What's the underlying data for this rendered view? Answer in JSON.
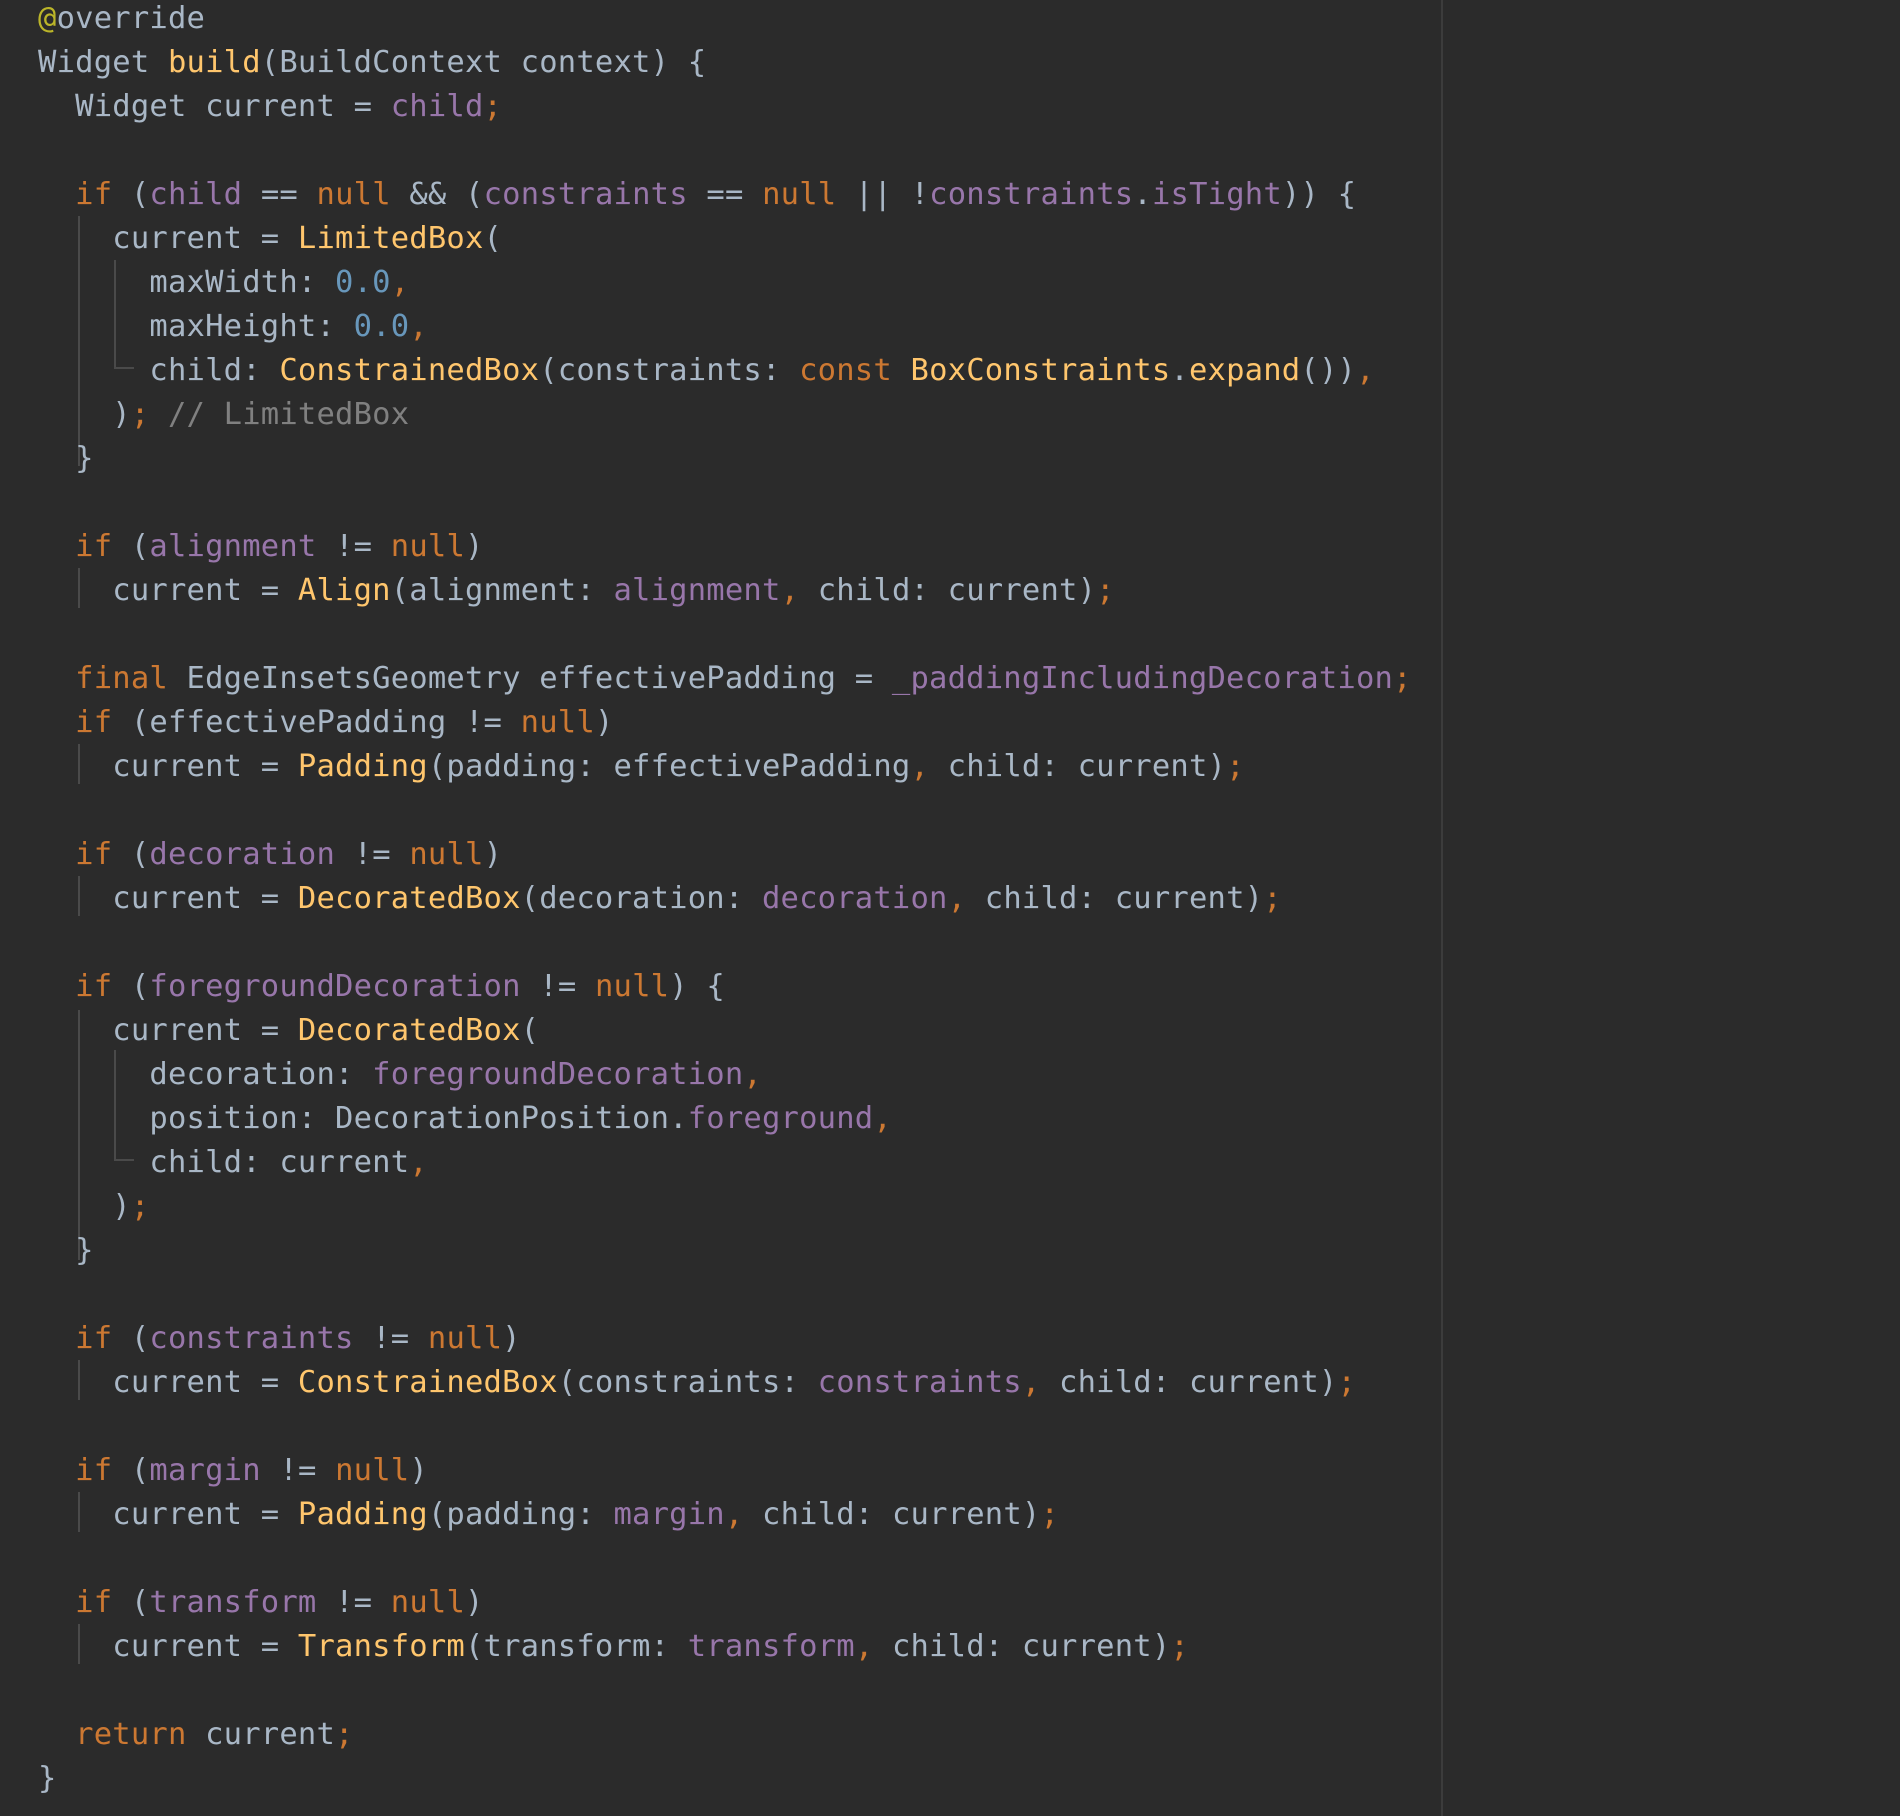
{
  "colors": {
    "background": "#2b2b2b",
    "plain": "#a9b7c6",
    "keyword": "#cc7832",
    "function": "#ffc66d",
    "field": "#9876aa",
    "number": "#6897bb",
    "comment": "#808080",
    "annotation": "#bbb529"
  },
  "code_lines": [
    [
      {
        "t": "@",
        "c": "anno"
      },
      {
        "t": "override",
        "c": "text"
      }
    ],
    [
      {
        "t": "Widget ",
        "c": "text"
      },
      {
        "t": "build",
        "c": "fn"
      },
      {
        "t": "(BuildContext context) {",
        "c": "text"
      }
    ],
    [
      {
        "t": "  Widget current = ",
        "c": "text"
      },
      {
        "t": "child",
        "c": "field"
      },
      {
        "t": ";",
        "c": "punct"
      }
    ],
    [],
    [
      {
        "t": "  ",
        "c": "text"
      },
      {
        "t": "if",
        "c": "kw"
      },
      {
        "t": " (",
        "c": "text"
      },
      {
        "t": "child",
        "c": "field"
      },
      {
        "t": " == ",
        "c": "text"
      },
      {
        "t": "null",
        "c": "kw"
      },
      {
        "t": " && (",
        "c": "text"
      },
      {
        "t": "constraints",
        "c": "field"
      },
      {
        "t": " == ",
        "c": "text"
      },
      {
        "t": "null",
        "c": "kw"
      },
      {
        "t": " || !",
        "c": "text"
      },
      {
        "t": "constraints",
        "c": "field"
      },
      {
        "t": ".",
        "c": "text"
      },
      {
        "t": "isTight",
        "c": "field"
      },
      {
        "t": ")) {",
        "c": "text"
      }
    ],
    [
      {
        "t": "    current = ",
        "c": "text"
      },
      {
        "t": "LimitedBox",
        "c": "fn"
      },
      {
        "t": "(",
        "c": "text"
      }
    ],
    [
      {
        "t": "      maxWidth: ",
        "c": "text"
      },
      {
        "t": "0.0",
        "c": "num"
      },
      {
        "t": ",",
        "c": "punct"
      }
    ],
    [
      {
        "t": "      maxHeight: ",
        "c": "text"
      },
      {
        "t": "0.0",
        "c": "num"
      },
      {
        "t": ",",
        "c": "punct"
      }
    ],
    [
      {
        "t": "      child: ",
        "c": "text"
      },
      {
        "t": "ConstrainedBox",
        "c": "fn"
      },
      {
        "t": "(constraints: ",
        "c": "text"
      },
      {
        "t": "const",
        "c": "kw"
      },
      {
        "t": " ",
        "c": "text"
      },
      {
        "t": "BoxConstraints",
        "c": "fn"
      },
      {
        "t": ".",
        "c": "text"
      },
      {
        "t": "expand",
        "c": "fn"
      },
      {
        "t": "())",
        "c": "text"
      },
      {
        "t": ",",
        "c": "punct"
      }
    ],
    [
      {
        "t": "    )",
        "c": "text"
      },
      {
        "t": ";",
        "c": "punct"
      },
      {
        "t": " // LimitedBox",
        "c": "cmt"
      }
    ],
    [
      {
        "t": "  }",
        "c": "text"
      }
    ],
    [],
    [
      {
        "t": "  ",
        "c": "text"
      },
      {
        "t": "if",
        "c": "kw"
      },
      {
        "t": " (",
        "c": "text"
      },
      {
        "t": "alignment",
        "c": "field"
      },
      {
        "t": " != ",
        "c": "text"
      },
      {
        "t": "null",
        "c": "kw"
      },
      {
        "t": ")",
        "c": "text"
      }
    ],
    [
      {
        "t": "    current = ",
        "c": "text"
      },
      {
        "t": "Align",
        "c": "fn"
      },
      {
        "t": "(alignment: ",
        "c": "text"
      },
      {
        "t": "alignment",
        "c": "field"
      },
      {
        "t": ", ",
        "c": "punct"
      },
      {
        "t": "child: current)",
        "c": "text"
      },
      {
        "t": ";",
        "c": "punct"
      }
    ],
    [],
    [
      {
        "t": "  ",
        "c": "text"
      },
      {
        "t": "final",
        "c": "kw"
      },
      {
        "t": " EdgeInsetsGeometry effectivePadding = ",
        "c": "text"
      },
      {
        "t": "_paddingIncludingDecoration",
        "c": "field"
      },
      {
        "t": ";",
        "c": "punct"
      }
    ],
    [
      {
        "t": "  ",
        "c": "text"
      },
      {
        "t": "if",
        "c": "kw"
      },
      {
        "t": " (effectivePadding != ",
        "c": "text"
      },
      {
        "t": "null",
        "c": "kw"
      },
      {
        "t": ")",
        "c": "text"
      }
    ],
    [
      {
        "t": "    current = ",
        "c": "text"
      },
      {
        "t": "Padding",
        "c": "fn"
      },
      {
        "t": "(padding: effectivePadding",
        "c": "text"
      },
      {
        "t": ", ",
        "c": "punct"
      },
      {
        "t": "child: current)",
        "c": "text"
      },
      {
        "t": ";",
        "c": "punct"
      }
    ],
    [],
    [
      {
        "t": "  ",
        "c": "text"
      },
      {
        "t": "if",
        "c": "kw"
      },
      {
        "t": " (",
        "c": "text"
      },
      {
        "t": "decoration",
        "c": "field"
      },
      {
        "t": " != ",
        "c": "text"
      },
      {
        "t": "null",
        "c": "kw"
      },
      {
        "t": ")",
        "c": "text"
      }
    ],
    [
      {
        "t": "    current = ",
        "c": "text"
      },
      {
        "t": "DecoratedBox",
        "c": "fn"
      },
      {
        "t": "(decoration: ",
        "c": "text"
      },
      {
        "t": "decoration",
        "c": "field"
      },
      {
        "t": ", ",
        "c": "punct"
      },
      {
        "t": "child: current)",
        "c": "text"
      },
      {
        "t": ";",
        "c": "punct"
      }
    ],
    [],
    [
      {
        "t": "  ",
        "c": "text"
      },
      {
        "t": "if",
        "c": "kw"
      },
      {
        "t": " (",
        "c": "text"
      },
      {
        "t": "foregroundDecoration",
        "c": "field"
      },
      {
        "t": " != ",
        "c": "text"
      },
      {
        "t": "null",
        "c": "kw"
      },
      {
        "t": ") {",
        "c": "text"
      }
    ],
    [
      {
        "t": "    current = ",
        "c": "text"
      },
      {
        "t": "DecoratedBox",
        "c": "fn"
      },
      {
        "t": "(",
        "c": "text"
      }
    ],
    [
      {
        "t": "      decoration: ",
        "c": "text"
      },
      {
        "t": "foregroundDecoration",
        "c": "field"
      },
      {
        "t": ",",
        "c": "punct"
      }
    ],
    [
      {
        "t": "      position: DecorationPosition.",
        "c": "text"
      },
      {
        "t": "foreground",
        "c": "field"
      },
      {
        "t": ",",
        "c": "punct"
      }
    ],
    [
      {
        "t": "      child: current",
        "c": "text"
      },
      {
        "t": ",",
        "c": "punct"
      }
    ],
    [
      {
        "t": "    )",
        "c": "text"
      },
      {
        "t": ";",
        "c": "punct"
      }
    ],
    [
      {
        "t": "  }",
        "c": "text"
      }
    ],
    [],
    [
      {
        "t": "  ",
        "c": "text"
      },
      {
        "t": "if",
        "c": "kw"
      },
      {
        "t": " (",
        "c": "text"
      },
      {
        "t": "constraints",
        "c": "field"
      },
      {
        "t": " != ",
        "c": "text"
      },
      {
        "t": "null",
        "c": "kw"
      },
      {
        "t": ")",
        "c": "text"
      }
    ],
    [
      {
        "t": "    current = ",
        "c": "text"
      },
      {
        "t": "ConstrainedBox",
        "c": "fn"
      },
      {
        "t": "(constraints: ",
        "c": "text"
      },
      {
        "t": "constraints",
        "c": "field"
      },
      {
        "t": ", ",
        "c": "punct"
      },
      {
        "t": "child: current)",
        "c": "text"
      },
      {
        "t": ";",
        "c": "punct"
      }
    ],
    [],
    [
      {
        "t": "  ",
        "c": "text"
      },
      {
        "t": "if",
        "c": "kw"
      },
      {
        "t": " (",
        "c": "text"
      },
      {
        "t": "margin",
        "c": "field"
      },
      {
        "t": " != ",
        "c": "text"
      },
      {
        "t": "null",
        "c": "kw"
      },
      {
        "t": ")",
        "c": "text"
      }
    ],
    [
      {
        "t": "    current = ",
        "c": "text"
      },
      {
        "t": "Padding",
        "c": "fn"
      },
      {
        "t": "(padding: ",
        "c": "text"
      },
      {
        "t": "margin",
        "c": "field"
      },
      {
        "t": ", ",
        "c": "punct"
      },
      {
        "t": "child: current)",
        "c": "text"
      },
      {
        "t": ";",
        "c": "punct"
      }
    ],
    [],
    [
      {
        "t": "  ",
        "c": "text"
      },
      {
        "t": "if",
        "c": "kw"
      },
      {
        "t": " (",
        "c": "text"
      },
      {
        "t": "transform",
        "c": "field"
      },
      {
        "t": " != ",
        "c": "text"
      },
      {
        "t": "null",
        "c": "kw"
      },
      {
        "t": ")",
        "c": "text"
      }
    ],
    [
      {
        "t": "    current = ",
        "c": "text"
      },
      {
        "t": "Transform",
        "c": "fn"
      },
      {
        "t": "(transform: ",
        "c": "text"
      },
      {
        "t": "transform",
        "c": "field"
      },
      {
        "t": ", ",
        "c": "punct"
      },
      {
        "t": "child: current)",
        "c": "text"
      },
      {
        "t": ";",
        "c": "punct"
      }
    ],
    [],
    [
      {
        "t": "  ",
        "c": "text"
      },
      {
        "t": "return",
        "c": "kw"
      },
      {
        "t": " current",
        "c": "text"
      },
      {
        "t": ";",
        "c": "punct"
      }
    ],
    [
      {
        "t": "}",
        "c": "text"
      }
    ]
  ]
}
